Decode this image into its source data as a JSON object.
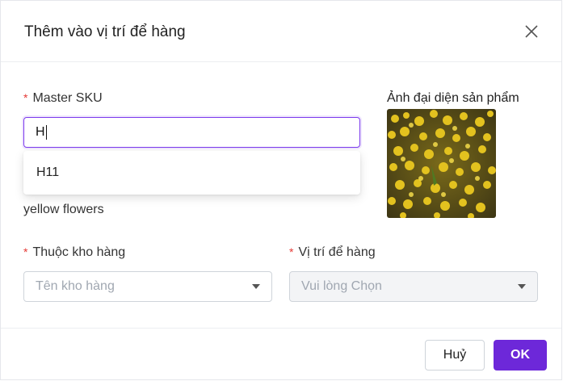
{
  "modal": {
    "title": "Thêm vào vị trí để hàng"
  },
  "sku": {
    "label": "Master SKU",
    "required_mark": "*",
    "value": "H",
    "suggestions": [
      "H11"
    ]
  },
  "product": {
    "name": "yellow flowers",
    "avatar_label": "Ảnh đại diện sản phẩm"
  },
  "warehouse": {
    "label": "Thuộc kho hàng",
    "required_mark": "*",
    "placeholder": "Tên kho hàng"
  },
  "location": {
    "label": "Vị trí để hàng",
    "required_mark": "*",
    "placeholder": "Vui lòng Chọn"
  },
  "footer": {
    "cancel_label": "Huỷ",
    "ok_label": "OK"
  },
  "colors": {
    "accent": "#6d28d9",
    "focus_border": "#7c3aed",
    "required": "#e53935"
  },
  "icons": {
    "close": "close-icon",
    "dropdown_arrow": "caret-down-icon"
  }
}
